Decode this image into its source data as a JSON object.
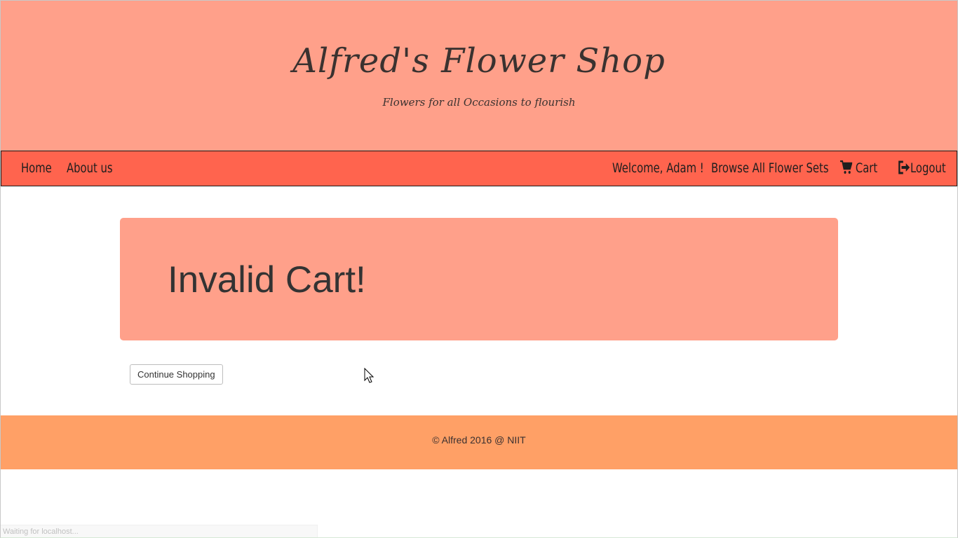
{
  "header": {
    "title": "Alfred's Flower Shop",
    "tagline": "Flowers for all Occasions to flourish"
  },
  "nav": {
    "home": "Home",
    "about": "About us",
    "welcome": "Welcome, Adam !",
    "browse": "Browse All Flower Sets",
    "cart": "Cart",
    "logout": "Logout"
  },
  "main": {
    "heading": "Invalid Cart!",
    "continue_button": "Continue Shopping"
  },
  "footer": {
    "text": "© Alfred 2016 @ NIIT"
  },
  "status_bar": {
    "text": "Waiting for localhost..."
  },
  "colors": {
    "header_bg": "#ffa08a",
    "navbar_bg": "#ff644e",
    "panel_bg": "#ffa08a",
    "footer_bg": "#ffa066"
  },
  "icons": {
    "cart": "shopping-cart-icon",
    "logout": "logout-icon"
  }
}
